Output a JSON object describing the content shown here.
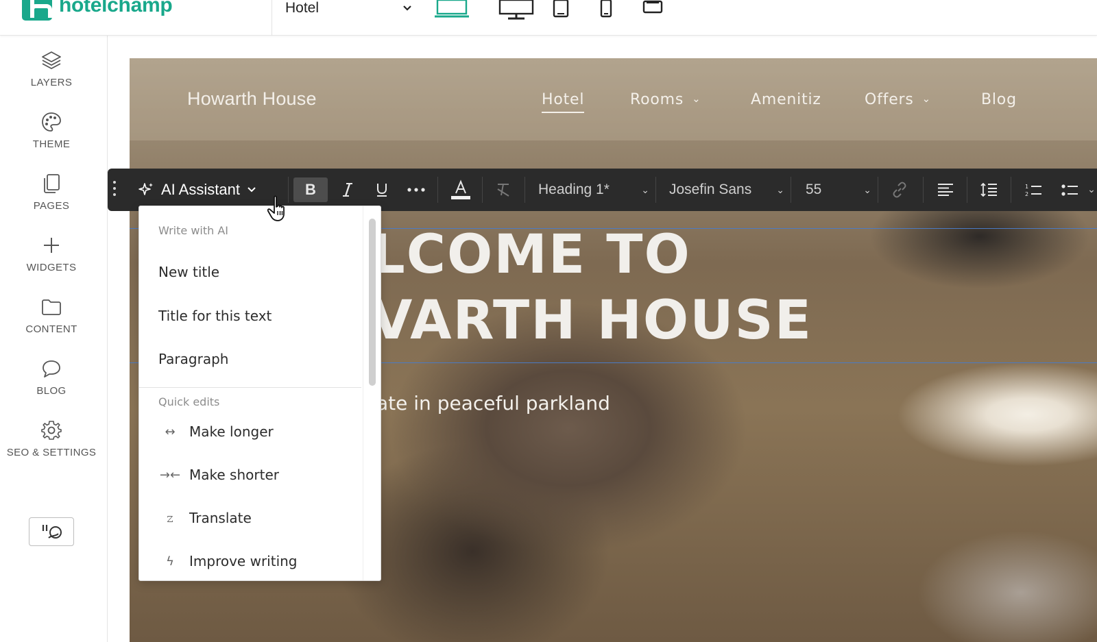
{
  "app": {
    "logo_text": "hotelchamp",
    "page_select": "Hotel",
    "devices": [
      "laptop-icon",
      "desktop-icon",
      "tablet-icon",
      "mobile-icon",
      "mobile-landscape-icon"
    ],
    "accent": "#19a88b"
  },
  "sidebar": {
    "items": [
      {
        "label": "LAYERS",
        "icon": "layers-icon"
      },
      {
        "label": "THEME",
        "icon": "palette-icon"
      },
      {
        "label": "PAGES",
        "icon": "pages-icon"
      },
      {
        "label": "WIDGETS",
        "icon": "plus-icon"
      },
      {
        "label": "CONTENT",
        "icon": "folder-icon"
      },
      {
        "label": "BLOG",
        "icon": "chat-bubble-icon"
      },
      {
        "label": "SEO & SETTINGS",
        "icon": "gear-icon"
      }
    ],
    "special_icon": "quote-widget-icon"
  },
  "site": {
    "brand": "Howarth House",
    "nav": [
      {
        "label": "Hotel",
        "active": true
      },
      {
        "label": "Rooms",
        "dropdown": true
      },
      {
        "label": "Amenitiz"
      },
      {
        "label": "Offers",
        "dropdown": true
      },
      {
        "label": "Blog"
      }
    ],
    "hero_line1": "LCOME TO",
    "hero_line2": "VARTH HOUSE",
    "hero_sub": "ate in peaceful parkland"
  },
  "toolbar": {
    "ai_label": "AI Assistant",
    "bold": "B",
    "style": "Heading 1*",
    "font": "Josefin Sans",
    "size": "55"
  },
  "ai_menu": {
    "section1": "Write with AI",
    "write_items": [
      "New title",
      "Title for this text",
      "Paragraph"
    ],
    "section2": "Quick edits",
    "quick_items": [
      {
        "label": "Make longer",
        "icon": "expand-arrows-icon"
      },
      {
        "label": "Make shorter",
        "icon": "shrink-arrows-icon"
      },
      {
        "label": "Translate",
        "icon": "translate-icon"
      },
      {
        "label": "Improve writing",
        "icon": "lightning-icon"
      }
    ]
  }
}
